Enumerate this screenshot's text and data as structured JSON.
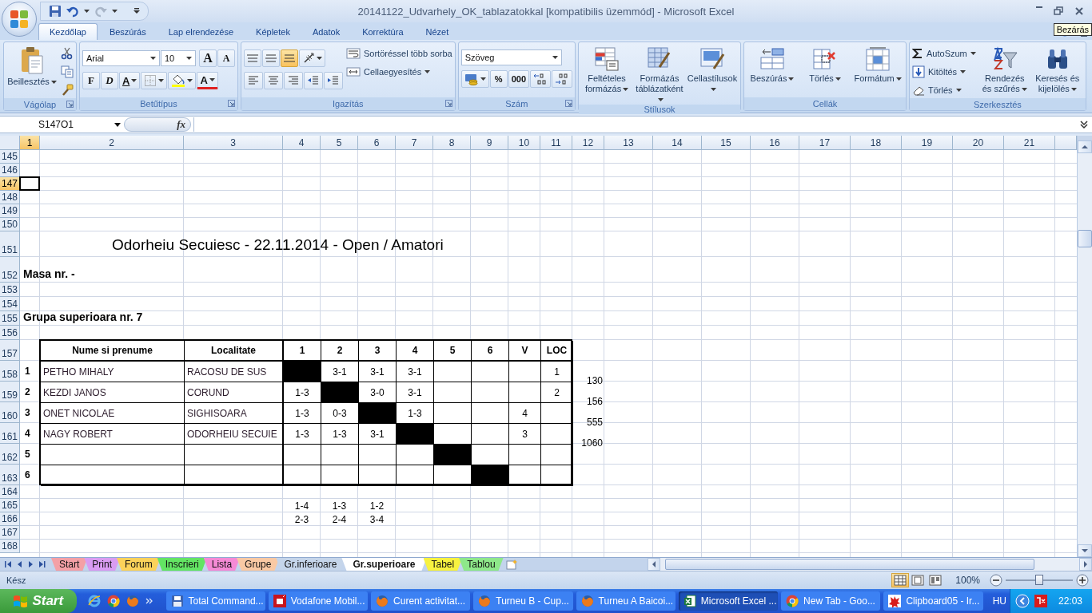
{
  "window": {
    "title": "20141122_Udvarhely_OK_tablazatokkal  [kompatibilis üzemmód] - Microsoft Excel",
    "tooltip": "Bezárás"
  },
  "ribbon": {
    "tabs": [
      {
        "label": "Kezdőlap",
        "selected": true
      },
      {
        "label": "Beszúrás",
        "selected": false
      },
      {
        "label": "Lap elrendezése",
        "selected": false
      },
      {
        "label": "Képletek",
        "selected": false
      },
      {
        "label": "Adatok",
        "selected": false
      },
      {
        "label": "Korrektúra",
        "selected": false
      },
      {
        "label": "Nézet",
        "selected": false
      }
    ],
    "groups": [
      {
        "name": "Vágólap",
        "columns": [
          {
            "kind": "big",
            "items": [
              {
                "kind": "paste",
                "label": "Beillesztés"
              }
            ]
          },
          {
            "kind": "stack",
            "items": [
              {
                "kind": "cut"
              },
              {
                "kind": "copy"
              },
              {
                "kind": "painter"
              }
            ]
          }
        ]
      },
      {
        "name": "Betűtípus",
        "columns": [
          {
            "kind": "rows",
            "top": [
              {
                "kind": "font-combo",
                "value": "Arial"
              },
              {
                "kind": "size-combo",
                "value": "10"
              },
              {
                "kind": "grow",
                "label": "A"
              },
              {
                "kind": "shrink",
                "label": "A"
              }
            ],
            "bottom": [
              {
                "kind": "bold",
                "label": "F"
              },
              {
                "kind": "italic",
                "label": "D"
              },
              {
                "kind": "underline",
                "label": "A"
              },
              {
                "kind": "borders"
              },
              {
                "kind": "fill"
              },
              {
                "kind": "fontcolor",
                "label": "A"
              }
            ]
          }
        ]
      },
      {
        "name": "Igazítás",
        "columns": [
          {
            "kind": "rows",
            "top": [
              {
                "kind": "align-top",
                "selected": false
              },
              {
                "kind": "align-middle",
                "selected": false
              },
              {
                "kind": "align-bottom",
                "selected": true
              },
              {
                "kind": "orient"
              }
            ],
            "bottom": [
              {
                "kind": "align-left",
                "selected": false
              },
              {
                "kind": "align-center",
                "selected": false
              },
              {
                "kind": "align-right",
                "selected": false
              },
              {
                "kind": "outdent"
              },
              {
                "kind": "indent"
              }
            ]
          },
          {
            "kind": "stack",
            "items": [
              {
                "kind": "wrap",
                "label": "Sortöréssel több sorba"
              },
              {
                "kind": "merge",
                "label": "Cellaegyesítés"
              }
            ]
          }
        ]
      },
      {
        "name": "Szám",
        "columns": [
          {
            "kind": "rows",
            "top": [
              {
                "kind": "format-combo",
                "value": "Szöveg"
              }
            ],
            "bottom": [
              {
                "kind": "currency"
              },
              {
                "kind": "percent",
                "label": "%"
              },
              {
                "kind": "thousands",
                "label": "000"
              },
              {
                "kind": "dec-more"
              },
              {
                "kind": "dec-less"
              }
            ]
          }
        ]
      },
      {
        "name": "Stílusok",
        "columns": [
          {
            "kind": "big",
            "items": [
              {
                "kind": "cond",
                "label": "Feltételes formázás"
              },
              {
                "kind": "tablefmt",
                "label": "Formázás táblázatként"
              },
              {
                "kind": "cellstyle",
                "label": "Cellastílusok"
              }
            ]
          }
        ]
      },
      {
        "name": "Cellák",
        "columns": [
          {
            "kind": "big",
            "items": [
              {
                "kind": "insert",
                "label": "Beszúrás"
              },
              {
                "kind": "delete",
                "label": "Törlés"
              },
              {
                "kind": "format",
                "label": "Formátum"
              }
            ]
          }
        ]
      },
      {
        "name": "Szerkesztés",
        "columns": [
          {
            "kind": "stack",
            "items": [
              {
                "kind": "sum",
                "label": "AutoSzum"
              },
              {
                "kind": "filldown",
                "label": "Kitöltés"
              },
              {
                "kind": "eraser",
                "label": "Törlés"
              }
            ]
          },
          {
            "kind": "big",
            "items": [
              {
                "kind": "sort",
                "label": "Rendezés és szűrés"
              },
              {
                "kind": "find",
                "label": "Keresés és kijelölés"
              }
            ]
          }
        ]
      }
    ]
  },
  "formula_bar": {
    "name_box": "S147O1",
    "function_button": "fx"
  },
  "sheet": {
    "columns": [
      {
        "label": "1",
        "selected": true
      },
      {
        "label": "2",
        "selected": false
      },
      {
        "label": "3",
        "selected": false
      },
      {
        "label": "4",
        "selected": false
      },
      {
        "label": "5",
        "selected": false
      },
      {
        "label": "6",
        "selected": false
      },
      {
        "label": "7",
        "selected": false
      },
      {
        "label": "8",
        "selected": false
      },
      {
        "label": "9",
        "selected": false
      },
      {
        "label": "10",
        "selected": false
      },
      {
        "label": "11",
        "selected": false
      },
      {
        "label": "12",
        "selected": false
      },
      {
        "label": "13",
        "selected": false
      },
      {
        "label": "14",
        "selected": false
      },
      {
        "label": "15",
        "selected": false
      },
      {
        "label": "16",
        "selected": false
      },
      {
        "label": "17",
        "selected": false
      },
      {
        "label": "18",
        "selected": false
      },
      {
        "label": "19",
        "selected": false
      },
      {
        "label": "20",
        "selected": false
      },
      {
        "label": "21",
        "selected": false
      }
    ],
    "rows": [
      {
        "number": "145",
        "selected": false
      },
      {
        "number": "146",
        "selected": false
      },
      {
        "number": "147",
        "selected": true
      },
      {
        "number": "148",
        "selected": false
      },
      {
        "number": "149",
        "selected": false
      },
      {
        "number": "150",
        "selected": false
      },
      {
        "number": "151",
        "selected": false
      },
      {
        "number": "152",
        "selected": false
      },
      {
        "number": "153",
        "selected": false
      },
      {
        "number": "154",
        "selected": false
      },
      {
        "number": "155",
        "selected": false
      },
      {
        "number": "156",
        "selected": false
      },
      {
        "number": "157",
        "selected": false
      },
      {
        "number": "158",
        "selected": false
      },
      {
        "number": "159",
        "selected": false
      },
      {
        "number": "160",
        "selected": false
      },
      {
        "number": "161",
        "selected": false
      },
      {
        "number": "162",
        "selected": false
      },
      {
        "number": "163",
        "selected": false
      },
      {
        "number": "164",
        "selected": false
      },
      {
        "number": "165",
        "selected": false
      },
      {
        "number": "166",
        "selected": false
      },
      {
        "number": "167",
        "selected": false
      },
      {
        "number": "168",
        "selected": false
      }
    ],
    "heading": "Odorheiu Secuiesc - 22.11.2014 - Open / Amatori",
    "table_label": "Masa nr.  -",
    "group_title": "Grupa superioara nr. 7",
    "standings": {
      "headers": [
        "Nume si prenume",
        "Localitate",
        "1",
        "2",
        "3",
        "4",
        "5",
        "6",
        "V",
        "LOC"
      ],
      "rows": [
        {
          "nr": "1",
          "name": "PETHO MIHALY",
          "town": "RACOSU DE SUS",
          "results": [
            {
              "kind": "blocked"
            },
            {
              "kind": "score",
              "text": "3-1"
            },
            {
              "kind": "score",
              "text": "3-1"
            },
            {
              "kind": "score",
              "text": "3-1"
            },
            {
              "kind": "empty"
            },
            {
              "kind": "empty"
            }
          ],
          "loc": "1"
        },
        {
          "nr": "2",
          "name": "KEZDI JANOS",
          "town": "CORUND",
          "results": [
            {
              "kind": "score",
              "text": "1-3"
            },
            {
              "kind": "blocked"
            },
            {
              "kind": "score",
              "text": "3-0"
            },
            {
              "kind": "score",
              "text": "3-1"
            },
            {
              "kind": "empty"
            },
            {
              "kind": "empty"
            }
          ],
          "loc": "2"
        },
        {
          "nr": "3",
          "name": "ONET NICOLAE",
          "town": "SIGHISOARA",
          "results": [
            {
              "kind": "score",
              "text": "1-3"
            },
            {
              "kind": "score",
              "text": "0-3"
            },
            {
              "kind": "blocked"
            },
            {
              "kind": "score",
              "text": "1-3"
            },
            {
              "kind": "empty"
            },
            {
              "kind": "empty"
            }
          ],
          "v": "4"
        },
        {
          "nr": "4",
          "name": "NAGY ROBERT",
          "town": "ODORHEIU SECUIE",
          "results": [
            {
              "kind": "score",
              "text": "1-3"
            },
            {
              "kind": "score",
              "text": "1-3"
            },
            {
              "kind": "score",
              "text": "3-1"
            },
            {
              "kind": "blocked"
            },
            {
              "kind": "empty"
            },
            {
              "kind": "empty"
            }
          ],
          "v": "3"
        },
        {
          "nr": "5",
          "results": [
            {
              "kind": "empty"
            },
            {
              "kind": "empty"
            },
            {
              "kind": "empty"
            },
            {
              "kind": "empty"
            },
            {
              "kind": "blocked"
            },
            {
              "kind": "empty"
            }
          ]
        },
        {
          "nr": "6",
          "results": [
            {
              "kind": "empty"
            },
            {
              "kind": "empty"
            },
            {
              "kind": "empty"
            },
            {
              "kind": "empty"
            },
            {
              "kind": "empty"
            },
            {
              "kind": "blocked"
            }
          ]
        }
      ]
    },
    "side_values": [
      "130",
      "156",
      "555",
      "1060"
    ],
    "pairings": [
      [
        "1-4",
        "2-3"
      ],
      [
        "1-3",
        "2-4"
      ],
      [
        "1-2",
        "3-4"
      ]
    ]
  },
  "sheet_tabs": [
    {
      "label": "Start",
      "selected": false,
      "color": "#f4a0a6"
    },
    {
      "label": "Print",
      "selected": false,
      "color": "#d99cf2"
    },
    {
      "label": "Forum",
      "selected": false,
      "color": "#fbd25a"
    },
    {
      "label": "Inscrieri",
      "selected": false,
      "color": "#63e463"
    },
    {
      "label": "Lista",
      "selected": false,
      "color": "#f58ad6"
    },
    {
      "label": "Grupe",
      "selected": false,
      "color": "#f9c9a4"
    },
    {
      "label": "Gr.inferioare",
      "selected": false,
      "color": "#c5d5ea"
    },
    {
      "label": "Gr.superioare",
      "selected": true
    },
    {
      "label": "Tabel",
      "selected": false,
      "color": "#f7f240"
    },
    {
      "label": "Tablou",
      "selected": false,
      "color": "#8ee88a"
    }
  ],
  "status_bar": {
    "status": "Kész",
    "views": [
      {
        "kind": "normal",
        "selected": true
      },
      {
        "kind": "layout",
        "selected": false
      },
      {
        "kind": "pagebreak",
        "selected": false
      }
    ],
    "zoom": {
      "reading": "100%",
      "level": 0.5
    }
  },
  "taskbar": {
    "start": "Start",
    "quick_launch": [
      {
        "kind": "ie"
      },
      {
        "kind": "chrome"
      },
      {
        "kind": "firefox"
      }
    ],
    "tasks": [
      {
        "kind": "floppy",
        "label": "Total Command...",
        "selected": false
      },
      {
        "kind": "vodafone",
        "label": "Vodafone Mobil...",
        "selected": false
      },
      {
        "kind": "firefox",
        "label": "Curent activitat...",
        "selected": false
      },
      {
        "kind": "firefox",
        "label": "Turneu B - Cup...",
        "selected": false
      },
      {
        "kind": "firefox",
        "label": "Turneu A Baicoi...",
        "selected": false
      },
      {
        "kind": "excel",
        "label": "Microsoft Excel ...",
        "selected": true
      },
      {
        "kind": "chrome",
        "label": "New Tab - Goo...",
        "selected": false
      },
      {
        "kind": "paint",
        "label": "Clipboard05 - Ir...",
        "selected": false
      }
    ],
    "language": "HU",
    "clock": "22:03"
  }
}
